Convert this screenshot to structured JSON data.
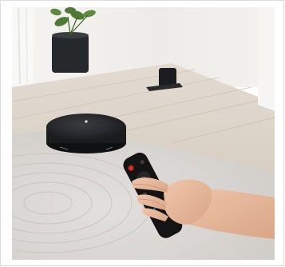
{
  "image": {
    "subject": "robot-vacuum-with-remote-control",
    "palette": {
      "wall": "#f1efec",
      "floor": "#d9d0c5",
      "rug": "#dcdad7",
      "robot": "#16181a",
      "skin": "#e7b99c",
      "remote": "#141414",
      "button_red": "#d42a1f"
    }
  }
}
